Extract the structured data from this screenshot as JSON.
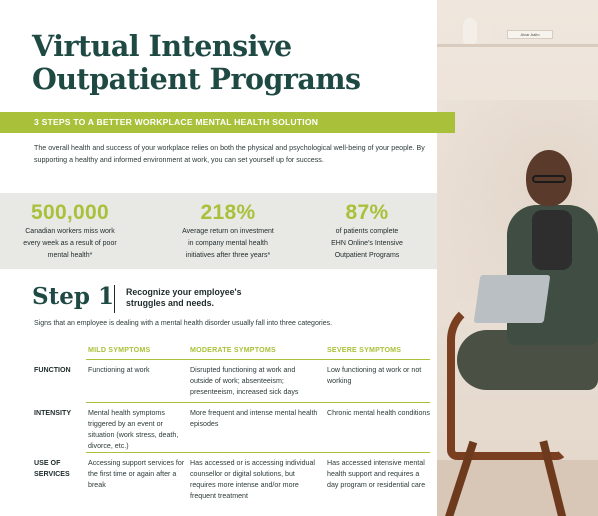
{
  "title_line1": "Virtual Intensive",
  "title_line2": "Outpatient Programs",
  "banner": "3 STEPS TO A BETTER WORKPLACE MENTAL HEALTH SOLUTION",
  "intro": "The overall health and success of your workplace relies on both the physical and psychological well-being of your people. By supporting a healthy and informed environment at work, you can set yourself up for success.",
  "stats": [
    {
      "number": "500,000",
      "line1": "Canadian workers miss work",
      "line2": "every week as a result of poor",
      "line3": "mental health*"
    },
    {
      "number": "218%",
      "line1": "Average return on investment",
      "line2": "in company mental health",
      "line3": "initiatives after three years*"
    },
    {
      "number": "87%",
      "line1": "of patients complete",
      "line2": "EHN Online's Intensive",
      "line3": "Outpatient Programs"
    }
  ],
  "step": {
    "label": "Step 1",
    "subtitle_line1": "Recognize your employee's",
    "subtitle_line2": "struggles and needs.",
    "signs": "Signs that an employee is dealing with a mental health disorder usually fall into three categories."
  },
  "table": {
    "headers": [
      "MILD SYMPTOMS",
      "MODERATE SYMPTOMS",
      "SEVERE SYMPTOMS"
    ],
    "rows": [
      {
        "label_line1": "FUNCTION",
        "label_line2": "",
        "mild": "Functioning at work",
        "moderate": "Disrupted functioning at work and outside of work; absenteeism; presenteeism, increased sick days",
        "severe": "Low functioning at work or not working"
      },
      {
        "label_line1": "INTENSITY",
        "label_line2": "",
        "mild": "Mental health symptoms triggered by an event or situation (work stress, death, divorce, etc.)",
        "moderate": "More frequent and intense mental health episodes",
        "severe": "Chronic mental health conditions"
      },
      {
        "label_line1": "USE OF",
        "label_line2": "SERVICES",
        "mild": "Accessing support services for the first time or again after a break",
        "moderate": "Has accessed or is accessing individual counsellor or digital solutions, but requires more intense and/or more frequent treatment",
        "severe": "Has accessed intensive mental health support and requires a day program or residential care"
      }
    ]
  },
  "photo_book_text": "Alvar Aalto",
  "colors": {
    "accent": "#a9c13a",
    "title": "#1f4a44",
    "stats_bg": "#e8e8e5"
  }
}
